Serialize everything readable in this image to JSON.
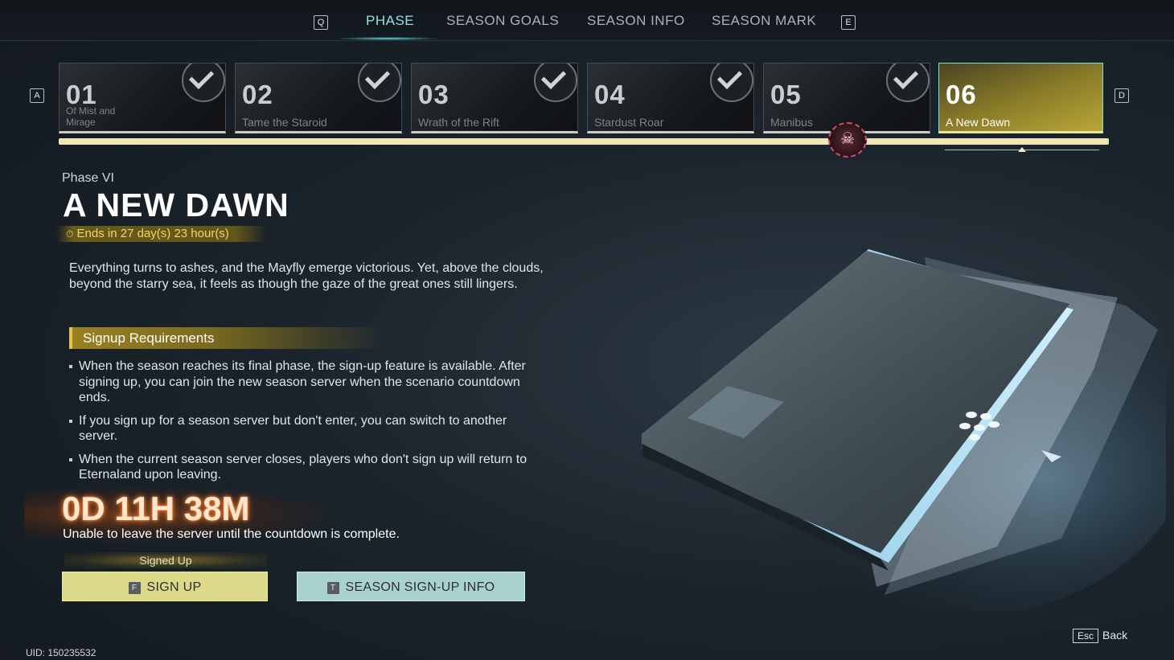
{
  "nav": {
    "prev_key": "Q",
    "next_key": "E",
    "tabs": [
      {
        "label": "PHASE",
        "active": true
      },
      {
        "label": "SEASON GOALS",
        "active": false
      },
      {
        "label": "SEASON INFO",
        "active": false
      },
      {
        "label": "SEASON MARK",
        "active": false
      }
    ]
  },
  "phases": {
    "prev_key": "A",
    "next_key": "D",
    "cards": [
      {
        "num": "01",
        "name": "Of Mist and Mirage",
        "completed": true
      },
      {
        "num": "02",
        "name": "Tame the Staroid",
        "completed": true
      },
      {
        "num": "03",
        "name": "Wrath of the Rift",
        "completed": true
      },
      {
        "num": "04",
        "name": "Stardust Roar",
        "completed": true
      },
      {
        "num": "05",
        "name": "Manibus",
        "completed": true
      },
      {
        "num": "06",
        "name": "A New Dawn",
        "completed": false,
        "current": true
      }
    ]
  },
  "detail": {
    "phase_label": "Phase VI",
    "title": "A NEW DAWN",
    "ends": "Ends in 27 day(s) 23 hour(s)",
    "description": "Everything turns to ashes, and the Mayfly emerge victorious. Yet, above the clouds, beyond the starry sea, it feels as though the gaze of the great ones still lingers.",
    "requirements_header": "Signup Requirements",
    "requirements": [
      "When the season reaches its final phase, the sign-up feature is available. After signing up, you can join the new season server when the scenario countdown ends.",
      "If you sign up for a season server but don't enter, you can switch to another server.",
      "When the current season server closes, players who don't sign up will return to Eternaland upon leaving."
    ],
    "countdown": "0D 11H 38M",
    "countdown_note": "Unable to leave the server until the countdown is complete.",
    "signed_up_label": "Signed Up"
  },
  "buttons": {
    "signup": {
      "key": "F",
      "label": "SIGN UP"
    },
    "info": {
      "key": "T",
      "label": "SEASON SIGN-UP INFO"
    }
  },
  "footer": {
    "esc_key": "Esc",
    "back_label": "Back",
    "uid": "UID: 150235532"
  },
  "colors": {
    "accent_teal": "#8ee3e6",
    "gold": "#f3d763",
    "signup_button": "#ddd98a",
    "info_button": "#a9d2cf"
  },
  "icons": [
    "checkmark-icon",
    "clock-icon",
    "boss-skull-icon",
    "season-tablet-artwork"
  ]
}
